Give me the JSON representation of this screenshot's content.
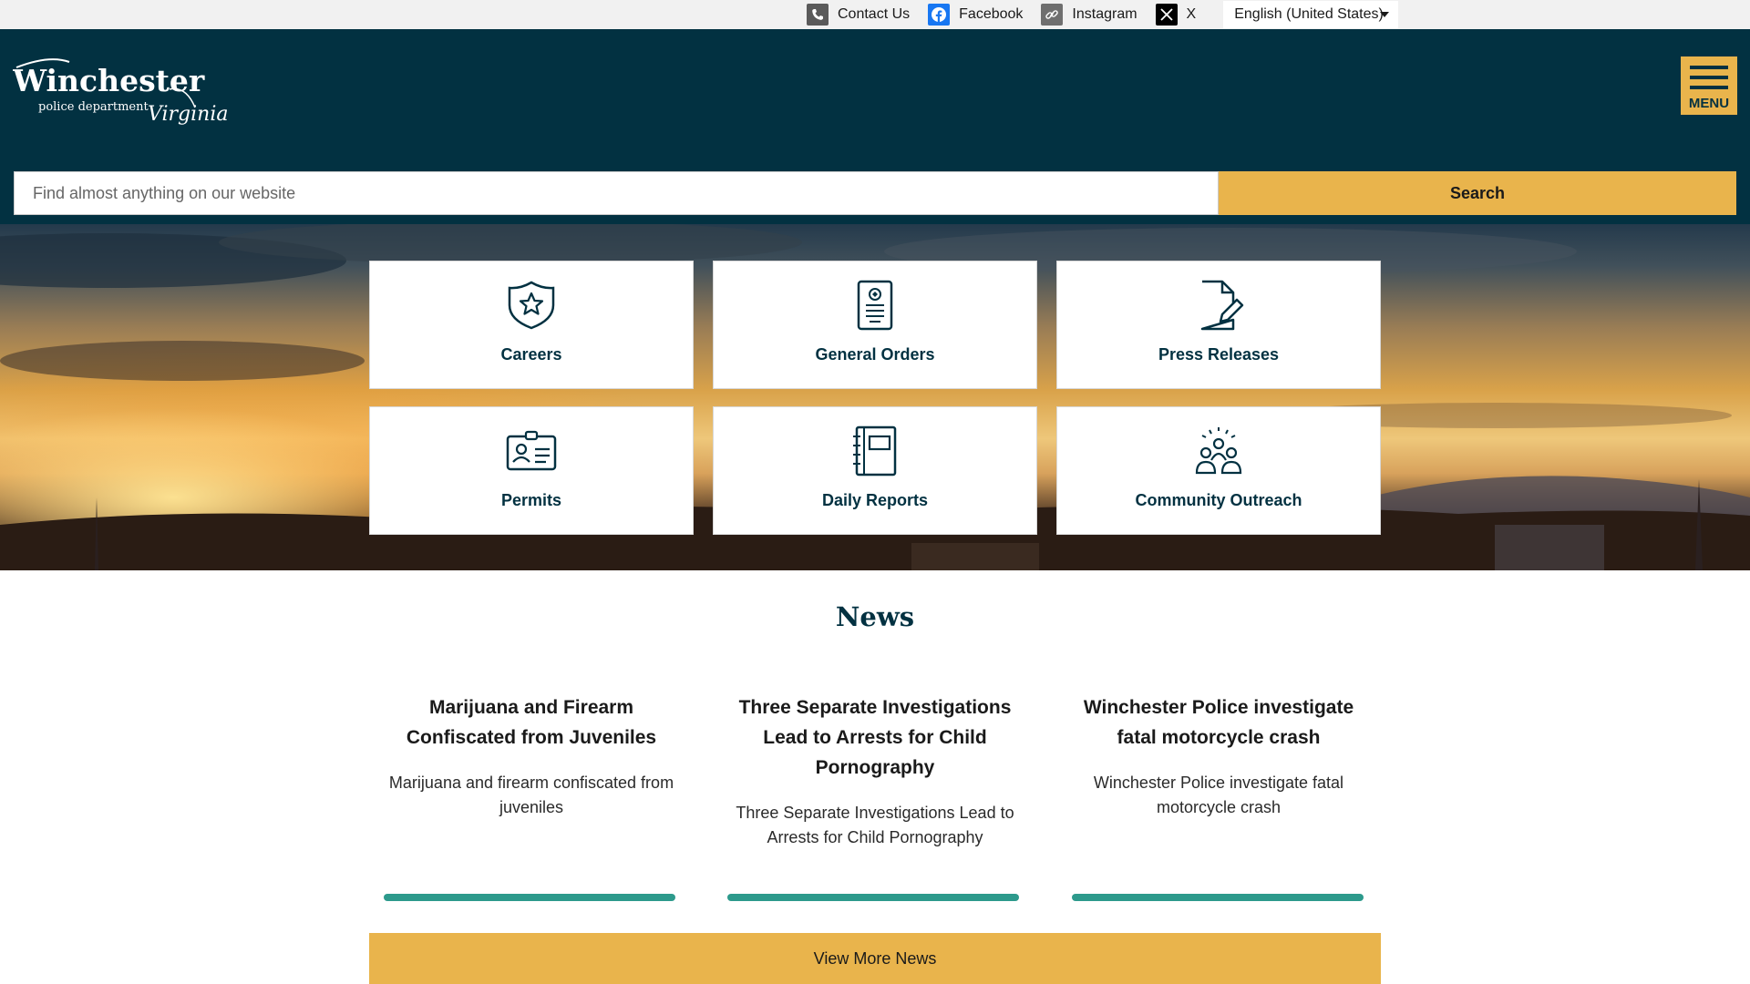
{
  "topbar": {
    "links": [
      {
        "label": "Contact Us",
        "icon": "phone-icon"
      },
      {
        "label": "Facebook",
        "icon": "facebook-icon"
      },
      {
        "label": "Instagram",
        "icon": "link-icon"
      },
      {
        "label": "X",
        "icon": "x-icon"
      }
    ],
    "language": "English (United States)"
  },
  "header": {
    "logo": {
      "wordmark": "Winchester",
      "subtitle": "police department",
      "script": "Virginia"
    },
    "menu_label": "MENU",
    "search": {
      "placeholder": "Find almost anything on our website",
      "button_label": "Search"
    }
  },
  "tiles": [
    {
      "label": "Careers",
      "icon": "badge-star-icon"
    },
    {
      "label": "General Orders",
      "icon": "document-seal-icon"
    },
    {
      "label": "Press Releases",
      "icon": "document-edit-icon"
    },
    {
      "label": "Permits",
      "icon": "id-card-icon"
    },
    {
      "label": "Daily Reports",
      "icon": "notebook-icon"
    },
    {
      "label": "Community Outreach",
      "icon": "community-group-icon"
    }
  ],
  "news": {
    "title": "News",
    "items": [
      {
        "headline": "Marijuana and Firearm Confiscated from Juveniles",
        "summary": "Marijuana and firearm confiscated from juveniles"
      },
      {
        "headline": "Three Separate Investigations Lead to Arrests for Child Pornography",
        "summary": "Three Separate Investigations Lead to Arrests for Child Pornography"
      },
      {
        "headline": "Winchester Police investigate fatal motorcycle crash",
        "summary": "Winchester Police investigate fatal motorcycle crash"
      }
    ],
    "more_label": "View More News"
  },
  "colors": {
    "navy": "#023141",
    "gold": "#e9b44c",
    "teal": "#2d9a8c"
  }
}
